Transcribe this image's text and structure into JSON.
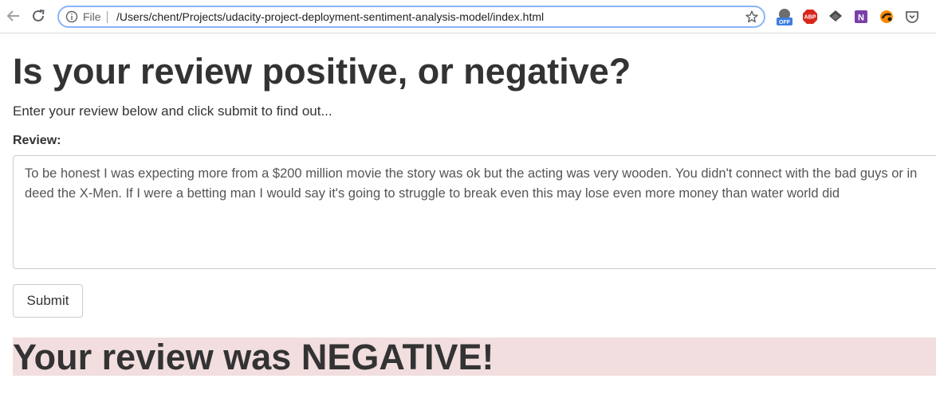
{
  "browser": {
    "file_label": "File",
    "url": "/Users/chent/Projects/udacity-project-deployment-sentiment-analysis-model/index.html",
    "extensions": [
      "off-extension-icon",
      "adblock-plus-icon",
      "layers-extension-icon",
      "onenote-icon",
      "sync-extension-icon",
      "pocket-icon"
    ],
    "extension_badges": {
      "off": "OFF",
      "abp": "ABP",
      "onenote": "N"
    }
  },
  "page": {
    "title": "Is your review positive, or negative?",
    "instructions": "Enter your review below and click submit to find out...",
    "review_label": "Review:",
    "review_text": "To be honest I was expecting more from a $200 million movie the story was ok but the acting was very wooden. You didn't connect with the bad guys or in deed the X-Men. If I were a betting man I would say it's going to struggle to break even this may lose even more money than water world did",
    "submit_label": "Submit",
    "result": "Your review was NEGATIVE!"
  },
  "colors": {
    "result_background": "#f2dede",
    "omnibox_focus": "#8ab4f8",
    "text": "#333333"
  }
}
